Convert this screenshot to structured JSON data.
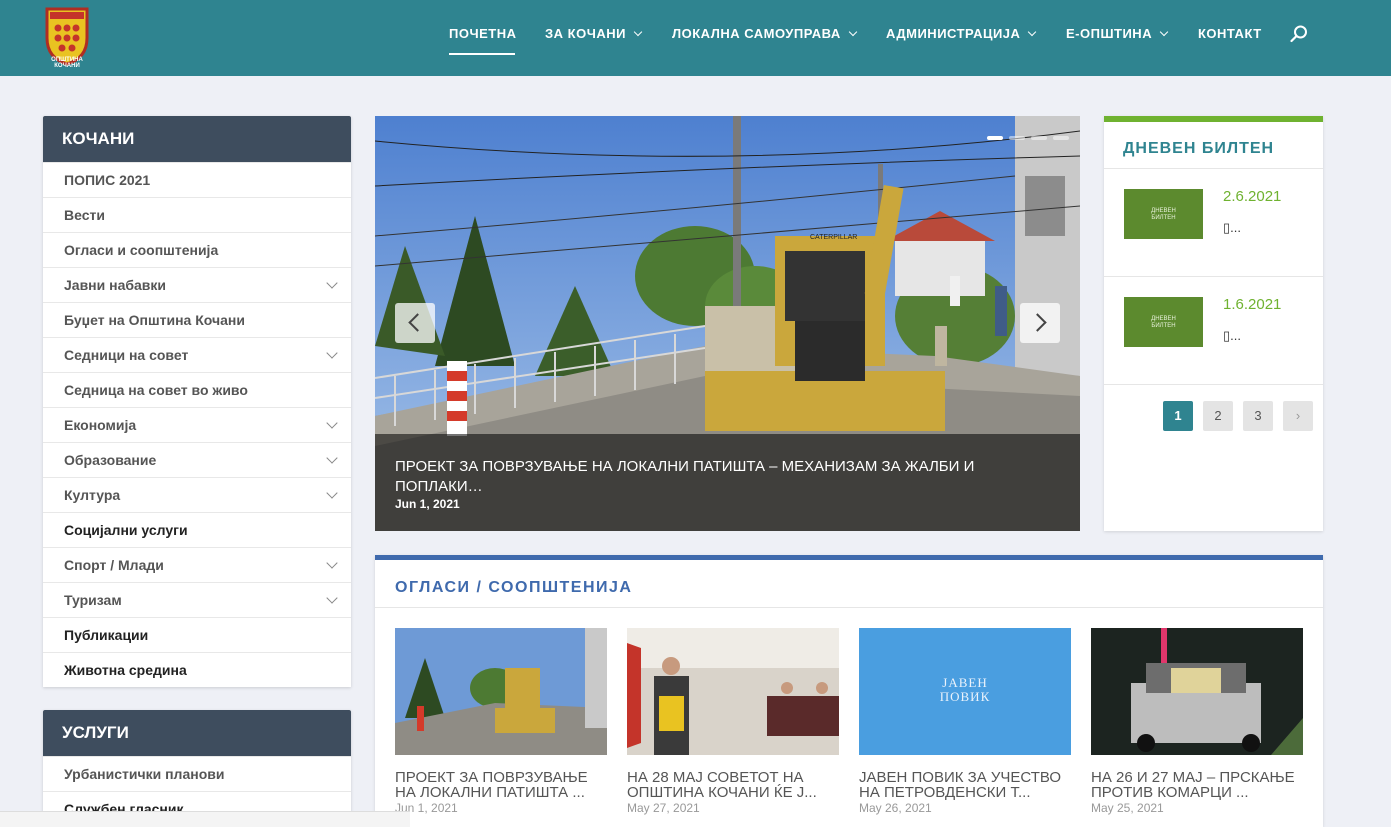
{
  "header": {
    "logo_text": "ОПШТИНА КОЧАНИ",
    "nav": [
      {
        "label": "ПОЧЕТНА",
        "has_dropdown": false,
        "active": true
      },
      {
        "label": "ЗА КОЧАНИ",
        "has_dropdown": true
      },
      {
        "label": "ЛОКАЛНА САМОУПРАВА",
        "has_dropdown": true
      },
      {
        "label": "АДМИНИСТРАЦИЈА",
        "has_dropdown": true
      },
      {
        "label": "Е-ОПШТИНА",
        "has_dropdown": true
      },
      {
        "label": "КОНТАКТ",
        "has_dropdown": false
      }
    ],
    "search_icon": "search-icon",
    "bg_color": "#2f8490"
  },
  "sidebar_kochani": {
    "title": "КОЧАНИ",
    "items": [
      {
        "label": "ПОПИС 2021",
        "has_sub": false
      },
      {
        "label": "Вести",
        "has_sub": false
      },
      {
        "label": "Огласи и соопштенија",
        "has_sub": false
      },
      {
        "label": "Јавни набавки",
        "has_sub": true
      },
      {
        "label": "Буџет на Општина Кочани",
        "has_sub": false
      },
      {
        "label": "Седници на совет",
        "has_sub": true
      },
      {
        "label": "Седница на совет во живо",
        "has_sub": false
      },
      {
        "label": "Економија",
        "has_sub": true
      },
      {
        "label": "Образование",
        "has_sub": true
      },
      {
        "label": "Култура",
        "has_sub": true
      },
      {
        "label": "Социјални услуги",
        "has_sub": false
      },
      {
        "label": "Спорт / Млади",
        "has_sub": true
      },
      {
        "label": "Туризам",
        "has_sub": true
      },
      {
        "label": "Публикации",
        "has_sub": false
      },
      {
        "label": "Животна средина",
        "has_sub": false
      }
    ]
  },
  "sidebar_uslugi": {
    "title": "УСЛУГИ",
    "items": [
      {
        "label": "Урбанистички планови"
      },
      {
        "label": "Службен гласник"
      }
    ]
  },
  "slider": {
    "title": "ПРОЕКТ ЗА ПОВРЗУВАЊЕ НА ЛОКАЛНИ ПАТИШТА – МЕХАНИЗАМ ЗА ЖАЛБИ И ПОПЛАКИ…",
    "date": "Jun 1, 2021",
    "machine_label": "CATERPILLAR",
    "dots": 4,
    "active_dot": 0
  },
  "bulletin": {
    "title": "ДНЕВЕН БИЛТЕН",
    "thumb_text_1": "ДНЕВЕН",
    "thumb_text_2": "БИЛТЕН",
    "entries": [
      {
        "date": "2.6.2021",
        "text": "▯..."
      },
      {
        "date": "1.6.2021",
        "text": "▯..."
      }
    ],
    "pages": [
      "1",
      "2",
      "3"
    ],
    "next": "›",
    "accent": "#6fb230"
  },
  "oglasi": {
    "title": "ОГЛАСИ / СООПШТЕНИЈА",
    "javen_povik_1": "ЈАВЕН",
    "javen_povik_2": "ПОВИК",
    "cards": [
      {
        "title": "ПРОЕКТ ЗА ПОВРЗУВАЊЕ НА ЛОКАЛНИ ПАТИШТА ...",
        "date": "Jun 1, 2021"
      },
      {
        "title": "НА 28 МАЈ СОВЕТОТ НА ОПШТИНА КОЧАНИ ЌЕ Ј...",
        "date": "May 27, 2021"
      },
      {
        "title": "ЈАВЕН ПОВИК ЗА УЧЕСТВО НА ПЕТРОВДЕНСКИ Т...",
        "date": "May 26, 2021"
      },
      {
        "title": "НА 26 И 27 МАЈ – ПРСКАЊЕ ПРОТИВ КОМАРЦИ ...",
        "date": "May 25, 2021"
      }
    ],
    "accent": "#3f6aad"
  }
}
